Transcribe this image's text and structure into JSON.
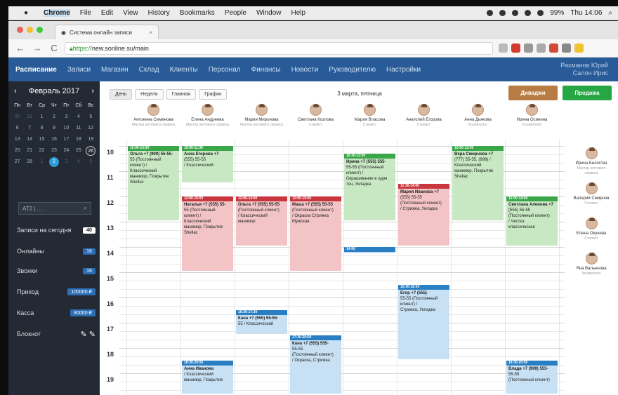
{
  "os_menu": {
    "apple": "●",
    "app": "Chrome",
    "items": [
      "File",
      "Edit",
      "View",
      "History",
      "Bookmarks",
      "People",
      "Window",
      "Help"
    ],
    "battery": "99%",
    "clock": "Thu 14:06"
  },
  "browser": {
    "tab_title": "Система онлайн записи",
    "url_scheme": "https://",
    "url_host": "new.sonline.su",
    "url_path": "/main"
  },
  "nav": {
    "items": [
      "Расписание",
      "Записи",
      "Магазин",
      "Склад",
      "Клиенты",
      "Персонал",
      "Финансы",
      "Новости",
      "Руководителю",
      "Настройки"
    ],
    "user_line1": "Рахманов Юрий",
    "user_line2": "Салон Ирис"
  },
  "sidebar": {
    "month": "Февраль 2017",
    "weekdays": [
      "Пн",
      "Вт",
      "Ср",
      "Чт",
      "Пт",
      "Сб",
      "Вс"
    ],
    "days": [
      [
        "30",
        "31",
        "1",
        "2",
        "3",
        "4",
        "5"
      ],
      [
        "6",
        "7",
        "8",
        "9",
        "10",
        "11",
        "12"
      ],
      [
        "13",
        "14",
        "15",
        "16",
        "17",
        "18",
        "19"
      ],
      [
        "20",
        "21",
        "22",
        "23",
        "24",
        "25",
        "26"
      ],
      [
        "27",
        "28",
        "1",
        "2",
        "3",
        "4",
        "5"
      ]
    ],
    "search_placeholder": "АТ2 | ...",
    "rows": [
      {
        "label": "Записи на сегодня",
        "value": "40"
      },
      {
        "label": "Онлайны",
        "value": "16"
      },
      {
        "label": "Звонки",
        "value": "16"
      },
      {
        "label": "Приход",
        "value": "100000 ₽"
      },
      {
        "label": "Касса",
        "value": "80000 ₽"
      },
      {
        "label": "Блокнот",
        "value": ""
      }
    ]
  },
  "toolbar": {
    "views": [
      "День",
      "Неделя",
      "Главная",
      "График"
    ],
    "date_title": "3 марта, пятница",
    "button_orange": "Диваджи",
    "button_green": "Продажа"
  },
  "staff": [
    {
      "name": "Антонина Семенова",
      "role": "Мастер ногтевого сервиса"
    },
    {
      "name": "Елена Андреева",
      "role": "Мастер ногтевого сервиса"
    },
    {
      "name": "Мария Миронова",
      "role": "Мастер ногтевого сервиса"
    },
    {
      "name": "Светлана Козлова",
      "role": "Стилист"
    },
    {
      "name": "Мария Власова",
      "role": "Стилист"
    },
    {
      "name": "Анатолий Егорова",
      "role": "Стилист"
    },
    {
      "name": "Анна Дьякова",
      "role": "Косметолог"
    },
    {
      "name": "Ирина Осинина",
      "role": "Косметолог"
    }
  ],
  "hours": [
    "10",
    "11",
    "12",
    "13",
    "14",
    "15",
    "16",
    "17",
    "18",
    "19"
  ],
  "appointments": [
    {
      "time": "10:00-13:00",
      "lines": [
        "Ольга +7 (999) 55-55-",
        "55 (Постоянный клиент) /",
        "Классический",
        "маникюр, Покрытие",
        "Shellac"
      ]
    },
    {
      "time": "10:00-11:30",
      "lines": [
        "Анна Егорова +7",
        "(555) 55-55",
        "/ Классический"
      ]
    },
    {
      "time": "12:00-15:00",
      "lines": [
        "Наталья +7 (555) 55-",
        "55 (Постоянный",
        "клиент) /",
        "Классический",
        "маникюр, Покрытие",
        "Shellac"
      ]
    },
    {
      "time": "12:00-14:00",
      "lines": [
        "Ольга +7 (555) 55-55",
        "(Постоянный клиент)",
        "/ Классический",
        "маникюр"
      ]
    },
    {
      "time": "12:00-15:00",
      "lines": [
        "Маша +7 (555) 55-55",
        "(Постоянный клиент)",
        "/ Окраска Стрижка",
        "Мужская"
      ]
    },
    {
      "time": "10:30-13:00",
      "lines": [
        "Ирина +7 (555) 555-",
        "55-55 (Постоянный",
        "клиент) /",
        "Окрашивание в один",
        "тон, Укладка"
      ]
    },
    {
      "time": "14:00",
      "lines": []
    },
    {
      "time": "11:30-14:00",
      "lines": [
        "Мария Иванова +7",
        "(555) 55-55",
        "(Постоянный клиент)",
        "/ Стрижка, Укладка"
      ]
    },
    {
      "time": "10:00-13:00",
      "lines": [
        "Вера Смирнова +7",
        "(777) 55-55, (999) /",
        "Классический",
        "маникюр, Покрытие",
        "Shellac"
      ]
    },
    {
      "time": "12:00-14:00",
      "lines": [
        "Светлана Аленова +7",
        "(555) 55-55",
        "(Постоянный клиент)",
        "/ Чистка",
        "классическая"
      ]
    },
    {
      "time": "15:30-18:30",
      "lines": [
        "Егор +7 (555)",
        "55-55 (Постоянный",
        "клиент) /",
        "Стрижка, Укладка"
      ]
    },
    {
      "time": "16:30-17:30",
      "lines": [
        "Кана +7 (555) 55-55-",
        "55 / Классический"
      ]
    },
    {
      "time": "17:30-20:00",
      "lines": [
        "Кана +7 (555) 555-",
        "55-55",
        "(Постоянный клиент)",
        "/ Окраска, Стрижка"
      ]
    },
    {
      "time": "18:30-20:00",
      "lines": [
        "Анна Иванова",
        "/ Классический",
        "маникюр, Покрытие"
      ]
    },
    {
      "time": "18:30-20:00",
      "lines": [
        "Влада +7 (999) 555-",
        "55-55",
        "(Постоянный клиент)"
      ]
    }
  ],
  "right_staff": [
    {
      "name": "Ирина Белоглаз",
      "role": "Мастер ногтевого сервиса"
    },
    {
      "name": "Валерий Смирнов",
      "role": "Стилист"
    },
    {
      "name": "Елена Окунева",
      "role": "Стилист"
    },
    {
      "name": "Яна Вальенова",
      "role": "Косметолог"
    }
  ],
  "colors": {
    "nav": "#285b97",
    "sidebar": "#232a33",
    "green": "#3aa64a",
    "red": "#c9363d",
    "blue": "#2a7fc4"
  }
}
